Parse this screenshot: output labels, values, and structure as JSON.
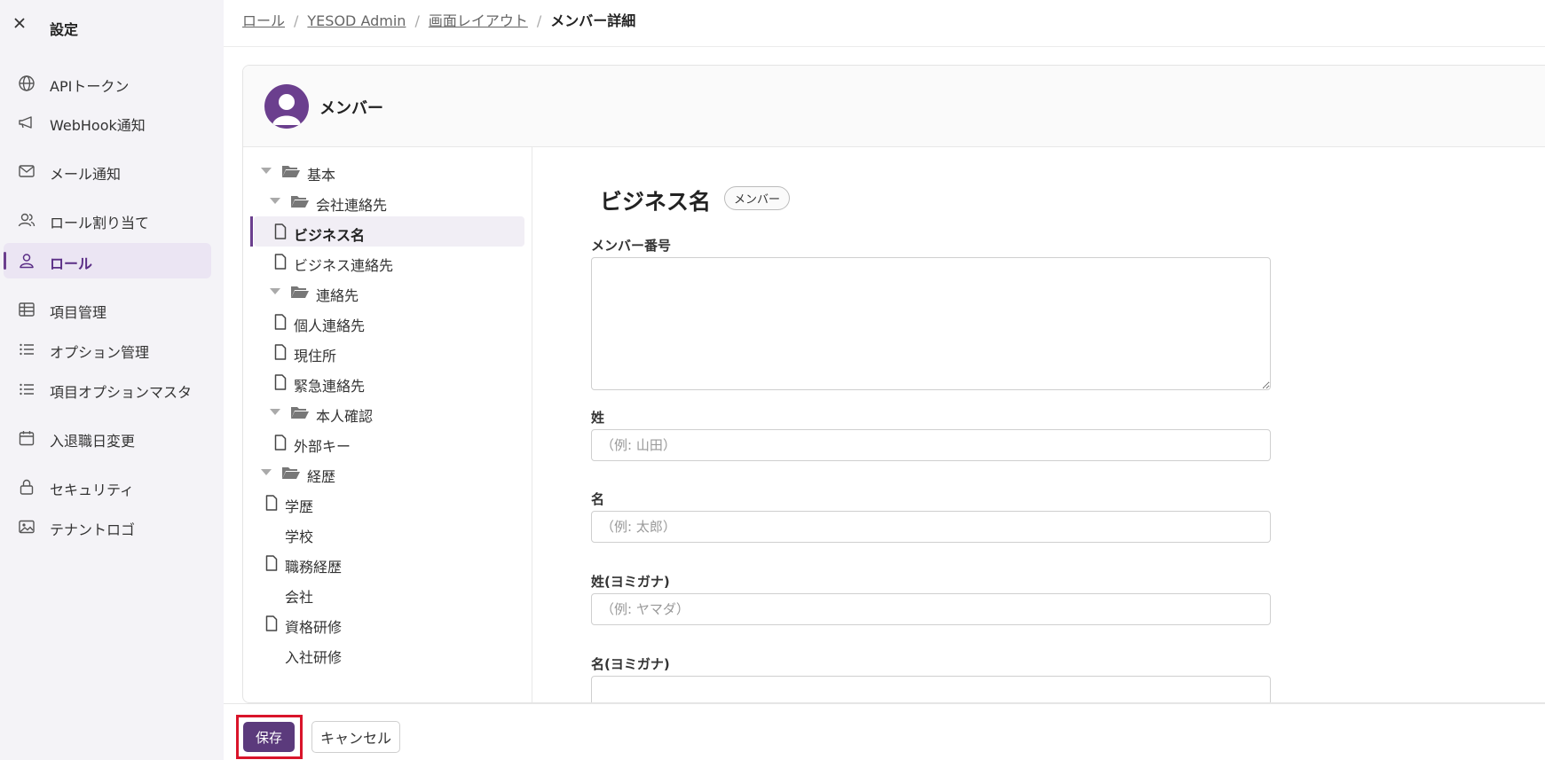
{
  "sidebar": {
    "title": "設定",
    "items": [
      {
        "label": "APIトークン",
        "icon": "globe-icon"
      },
      {
        "label": "WebHook通知",
        "icon": "megaphone-icon"
      },
      {
        "label": "メール通知",
        "icon": "mail-icon"
      },
      {
        "label": "ロール割り当て",
        "icon": "users-icon"
      },
      {
        "label": "ロール",
        "icon": "user-icon",
        "active": true
      },
      {
        "label": "項目管理",
        "icon": "table-icon"
      },
      {
        "label": "オプション管理",
        "icon": "list-icon"
      },
      {
        "label": "項目オプションマスタ",
        "icon": "list-icon"
      },
      {
        "label": "入退職日変更",
        "icon": "calendar-icon"
      },
      {
        "label": "セキュリティ",
        "icon": "lock-icon"
      },
      {
        "label": "テナントロゴ",
        "icon": "image-icon"
      }
    ]
  },
  "breadcrumb": [
    "ロール",
    "YESOD Admin",
    "画面レイアウト",
    "メンバー詳細"
  ],
  "card": {
    "title": "メンバー"
  },
  "tree": [
    {
      "label": "基本",
      "type": "folder"
    },
    {
      "label": "会社連絡先",
      "type": "folder"
    },
    {
      "label": "ビジネス名",
      "type": "file",
      "selected": true
    },
    {
      "label": "ビジネス連絡先",
      "type": "file"
    },
    {
      "label": "連絡先",
      "type": "folder"
    },
    {
      "label": "個人連絡先",
      "type": "file"
    },
    {
      "label": "現住所",
      "type": "file"
    },
    {
      "label": "緊急連絡先",
      "type": "file"
    },
    {
      "label": "本人確認",
      "type": "folder"
    },
    {
      "label": "外部キー",
      "type": "file"
    },
    {
      "label": "経歴",
      "type": "folder"
    },
    {
      "label": "学歴",
      "type": "file"
    },
    {
      "label": "学校",
      "type": "item"
    },
    {
      "label": "職務経歴",
      "type": "file"
    },
    {
      "label": "会社",
      "type": "item"
    },
    {
      "label": "資格研修",
      "type": "file"
    },
    {
      "label": "入社研修",
      "type": "item"
    }
  ],
  "form": {
    "title": "ビジネス名",
    "badge": "メンバー",
    "fields": [
      {
        "label": "メンバー番号",
        "placeholder": "",
        "value": ""
      },
      {
        "label": "姓",
        "placeholder": "（例: 山田）",
        "value": ""
      },
      {
        "label": "名",
        "placeholder": "（例: 太郎）",
        "value": ""
      },
      {
        "label": "姓(ヨミガナ)",
        "placeholder": "（例: ヤマダ）",
        "value": ""
      },
      {
        "label": "名(ヨミガナ)",
        "placeholder": "",
        "value": ""
      }
    ]
  },
  "footer": {
    "save_label": "保存",
    "cancel_label": "キャンセル"
  },
  "colors": {
    "accent": "#5b3a7c",
    "highlight": "#d9142a",
    "sidebar_bg": "#f4f3f7"
  }
}
